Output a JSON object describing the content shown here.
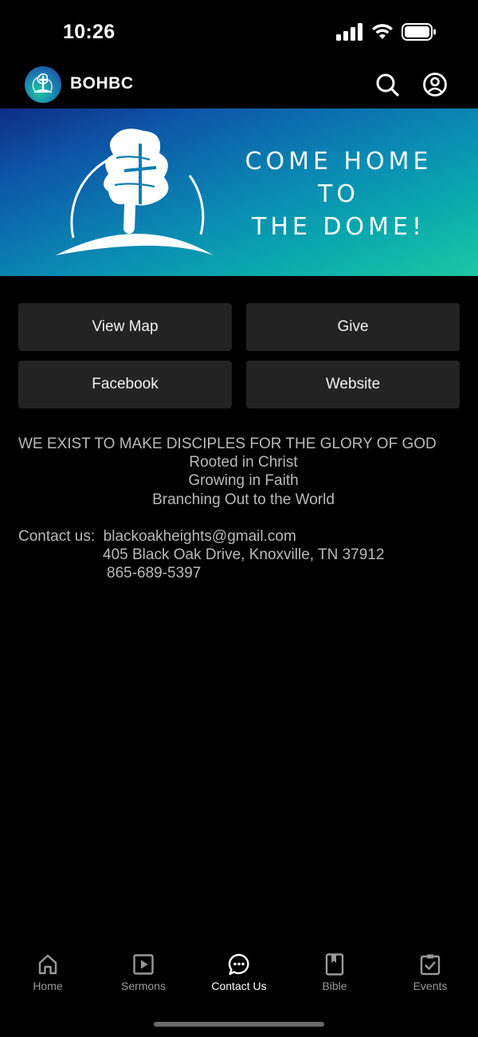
{
  "status": {
    "time": "10:26"
  },
  "header": {
    "title": "BOHBC"
  },
  "banner": {
    "lines": [
      "COME HOME",
      "TO",
      "THE DOME!"
    ]
  },
  "buttons": [
    {
      "label": "View Map"
    },
    {
      "label": "Give"
    },
    {
      "label": "Facebook"
    },
    {
      "label": "Website"
    }
  ],
  "info": {
    "mission": "WE EXIST TO MAKE DISCIPLES FOR THE GLORY OF GOD",
    "lines": [
      "Rooted in Christ",
      "Growing in Faith",
      "Branching Out to the World"
    ]
  },
  "contact": {
    "label": "Contact us:",
    "email": "blackoakheights@gmail.com",
    "address": "405 Black Oak Drive, Knoxville, TN 37912",
    "phone": "865-689-5397"
  },
  "tabs": [
    {
      "label": "Home",
      "icon": "home-icon"
    },
    {
      "label": "Sermons",
      "icon": "play-icon"
    },
    {
      "label": "Contact Us",
      "icon": "chat-icon",
      "active": true
    },
    {
      "label": "Bible",
      "icon": "book-icon"
    },
    {
      "label": "Events",
      "icon": "calendar-check-icon"
    }
  ],
  "colors": {
    "background": "#000000",
    "button": "#232323",
    "text_muted": "#b9b9b9",
    "tab_inactive": "#9a9a9a"
  }
}
